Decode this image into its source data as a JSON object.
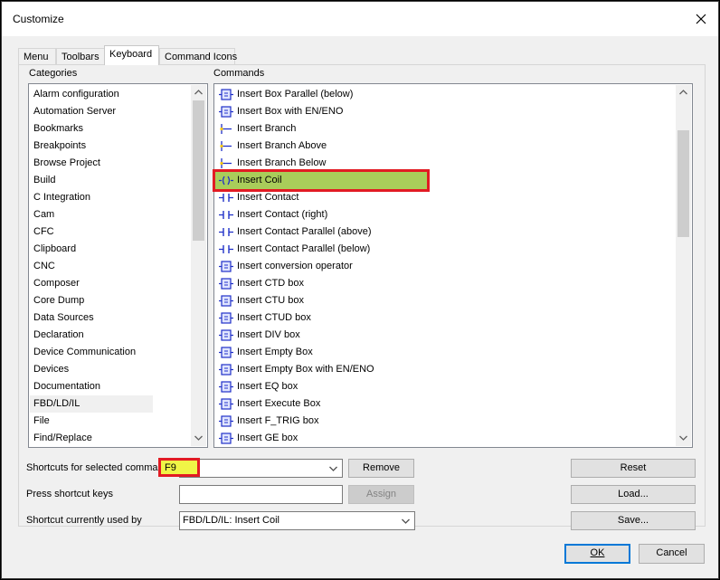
{
  "window": {
    "title": "Customize"
  },
  "tabs": [
    {
      "label": "Menu"
    },
    {
      "label": "Toolbars"
    },
    {
      "label": "Keyboard"
    },
    {
      "label": "Command Icons"
    }
  ],
  "categories": {
    "label": "Categories",
    "selected": "FBD/LD/IL",
    "items": [
      "Alarm configuration",
      "Automation Server",
      "Bookmarks",
      "Breakpoints",
      "Browse Project",
      "Build",
      "C Integration",
      "Cam",
      "CFC",
      "Clipboard",
      "CNC",
      "Composer",
      "Core Dump",
      "Data Sources",
      "Declaration",
      "Device Communication",
      "Devices",
      "Documentation",
      "FBD/LD/IL",
      "File",
      "Find/Replace"
    ]
  },
  "commands": {
    "label": "Commands",
    "selected": "Insert Coil",
    "items": [
      {
        "label": "Insert Box Parallel (below)",
        "icon": "box-parallel-below-icon"
      },
      {
        "label": "Insert Box with EN/ENO",
        "icon": "box-en-eno-icon"
      },
      {
        "label": "Insert Branch",
        "icon": "branch-icon"
      },
      {
        "label": "Insert Branch Above",
        "icon": "branch-above-icon"
      },
      {
        "label": "Insert Branch Below",
        "icon": "branch-below-icon"
      },
      {
        "label": "Insert Coil",
        "icon": "coil-icon"
      },
      {
        "label": "Insert Contact",
        "icon": "contact-icon"
      },
      {
        "label": "Insert Contact (right)",
        "icon": "contact-right-icon"
      },
      {
        "label": "Insert Contact Parallel (above)",
        "icon": "contact-parallel-above-icon"
      },
      {
        "label": "Insert Contact Parallel (below)",
        "icon": "contact-parallel-below-icon"
      },
      {
        "label": "Insert conversion operator",
        "icon": "conversion-operator-icon"
      },
      {
        "label": "Insert CTD box",
        "icon": "ctd-box-icon"
      },
      {
        "label": "Insert CTU box",
        "icon": "ctu-box-icon"
      },
      {
        "label": "Insert CTUD box",
        "icon": "ctud-box-icon"
      },
      {
        "label": "Insert DIV box",
        "icon": "div-box-icon"
      },
      {
        "label": "Insert Empty Box",
        "icon": "empty-box-icon"
      },
      {
        "label": "Insert Empty Box with EN/ENO",
        "icon": "empty-box-en-eno-icon"
      },
      {
        "label": "Insert EQ box",
        "icon": "eq-box-icon"
      },
      {
        "label": "Insert Execute Box",
        "icon": "execute-box-icon"
      },
      {
        "label": "Insert F_TRIG box",
        "icon": "f-trig-box-icon"
      },
      {
        "label": "Insert GE box",
        "icon": "ge-box-icon"
      }
    ]
  },
  "shortcuts": {
    "selected_label": "Shortcuts for selected command",
    "selected_value": "F9",
    "press_label": "Press shortcut keys",
    "press_value": "",
    "used_by_label": "Shortcut currently used by",
    "used_by_value": "FBD/LD/IL: Insert Coil"
  },
  "buttons": {
    "remove": "Remove",
    "assign": "Assign",
    "reset": "Reset",
    "load": "Load...",
    "save": "Save...",
    "ok": "OK",
    "cancel": "Cancel"
  },
  "colors": {
    "selection_highlight": "#a9cd5a",
    "annotation_red": "#e21b23",
    "annotation_yellow": "#f0f546",
    "icon_blue": "#2030c8"
  }
}
